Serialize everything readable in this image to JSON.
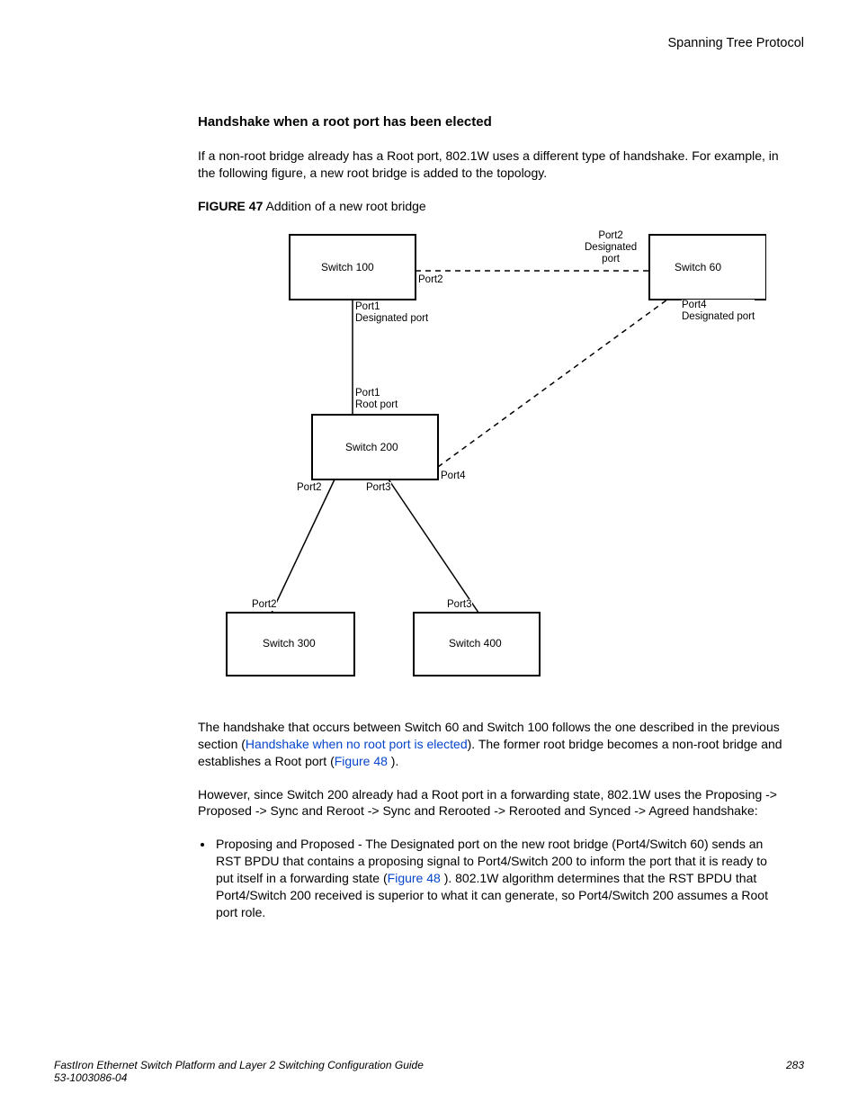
{
  "header": {
    "section": "Spanning Tree Protocol"
  },
  "section_heading": "Handshake when a root port has been elected",
  "para1": "If a non-root bridge already has a Root port, 802.1W uses a different type of handshake. For example, in the following figure, a new root bridge is added to the topology.",
  "figure": {
    "label": "FIGURE 47",
    "title": "Addition of a new root bridge",
    "labels": {
      "switch100": "Switch 100",
      "switch60": "Switch 60",
      "switch200": "Switch 200",
      "switch300": "Switch 300",
      "switch400": "Switch 400",
      "port2_top": "Port2",
      "desig_port_top": "Port2\nDesignated\nport",
      "port4_desig": "Port4\nDesignated port",
      "port1_desig": "Port1\nDesignated port",
      "port1_root": "Port1\nRoot port",
      "port4_right": "Port4",
      "port2_left": "Port2",
      "port3": "Port3",
      "port2_btm": "Port2",
      "port3_btm": "Port3"
    }
  },
  "para2_pre": "The handshake that occurs between Switch 60 and Switch 100 follows the one described in the previous section (",
  "para2_link1": "Handshake when no root port is elected",
  "para2_mid": "). The former root bridge becomes a non-root bridge and establishes a Root port (",
  "para2_link2": "Figure 48 ",
  "para2_post": ").",
  "para3": "However, since Switch 200 already had a Root port in a forwarding state, 802.1W uses the Proposing -> Proposed -> Sync and Reroot -> Sync and Rerooted -> Rerooted and Synced -> Agreed handshake:",
  "bullet1_pre": "Proposing and Proposed - The Designated port on the new root bridge (Port4/Switch 60) sends an RST BPDU that contains a proposing signal to Port4/Switch 200 to inform the port that it is ready to put itself in a forwarding state (",
  "bullet1_link": "Figure 48 ",
  "bullet1_post": "). 802.1W algorithm determines that the RST BPDU that Port4/Switch 200 received is superior to what it can generate, so Port4/Switch 200 assumes a Root port role.",
  "footer": {
    "left_line1": "FastIron Ethernet Switch Platform and Layer 2 Switching Configuration Guide",
    "left_line2": "53-1003086-04",
    "page": "283"
  }
}
